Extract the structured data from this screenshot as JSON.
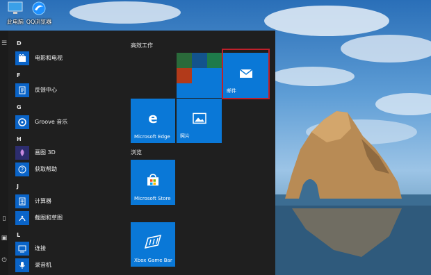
{
  "desktop": {
    "icons": [
      {
        "label": "此电脑",
        "icon": "computer-icon"
      },
      {
        "label": "QQ浏览器",
        "icon": "qq-browser-icon"
      }
    ]
  },
  "start_menu": {
    "rail_icons": [
      "hamburger-menu-icon",
      "document-icon",
      "power-icon",
      "photos-icon"
    ],
    "sections": {
      "d": "D",
      "f": "F",
      "g": "G",
      "h": "H",
      "j": "J",
      "l": "L"
    },
    "apps": {
      "movies": "电影和电视",
      "feedback": "反馈中心",
      "groove": "Groove 音乐",
      "paint3d": "画图 3D",
      "gethelp": "获取帮助",
      "calculator": "计算器",
      "snip": "截图和草图",
      "connect": "连接",
      "recorder": "录音机"
    },
    "groups": {
      "productivity": "高效工作",
      "browse": "浏览"
    },
    "tiles": {
      "mail": "邮件",
      "edge": "Microsoft Edge",
      "photos": "照片",
      "store": "Microsoft Store",
      "xbox": "Xbox Game Bar"
    },
    "colors": {
      "tile_blue": "#0a78d7",
      "menu_bg": "#1f1f1f",
      "highlight": "#c0202a"
    }
  }
}
